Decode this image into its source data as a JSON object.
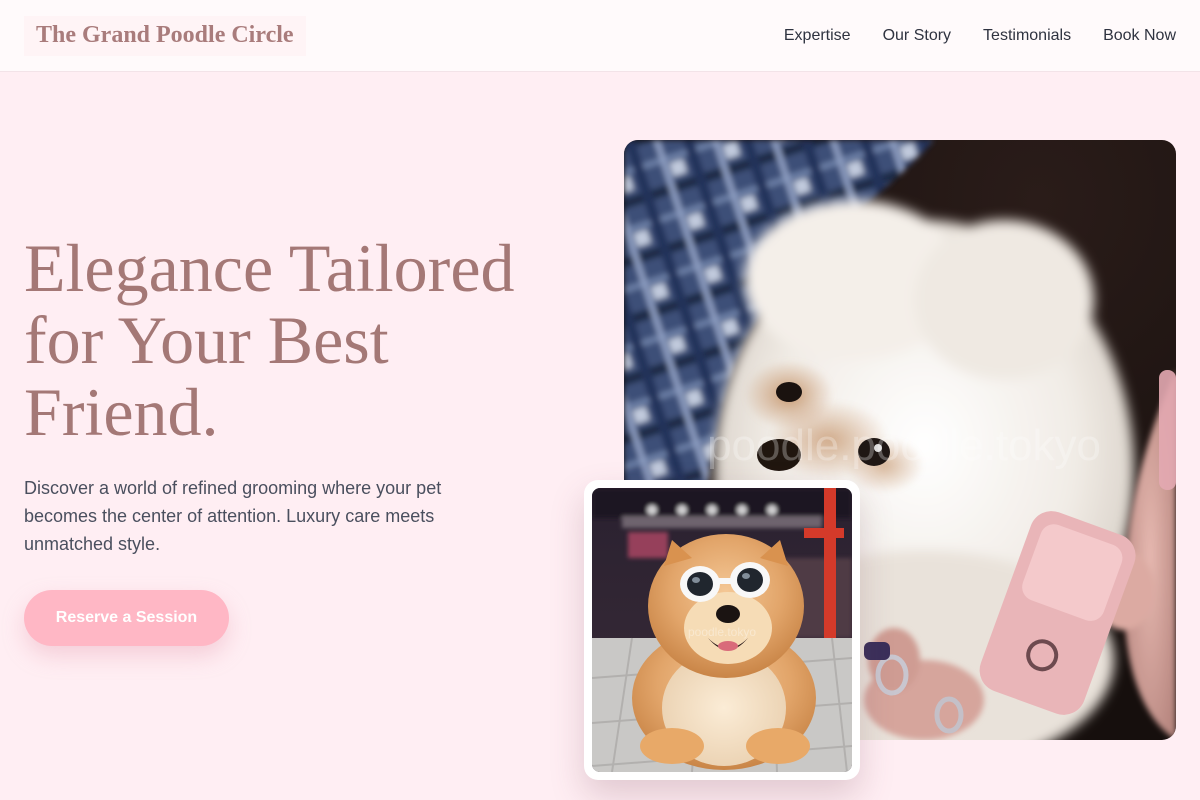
{
  "header": {
    "brand": "The Grand Poodle Circle",
    "nav": [
      {
        "label": "Expertise"
      },
      {
        "label": "Our Story"
      },
      {
        "label": "Testimonials"
      },
      {
        "label": "Book Now"
      }
    ]
  },
  "hero": {
    "title": "Elegance Tailored for Your Best Friend.",
    "description": "Discover a world of refined grooming where your pet becomes the center of attention. Luxury care meets unmatched style.",
    "cta_label": "Reserve a Session"
  },
  "images": {
    "main_watermark": "poodle.poodle.tokyo",
    "small_watermark": "poodle.tokyo"
  },
  "colors": {
    "background": "#ffeef3",
    "header_background": "#fffafb",
    "brand_text": "#a97c7c",
    "title_text": "#a47876",
    "body_text": "#4a4f5e",
    "cta_background": "#ffb7c5",
    "cta_text": "#ffffff"
  }
}
